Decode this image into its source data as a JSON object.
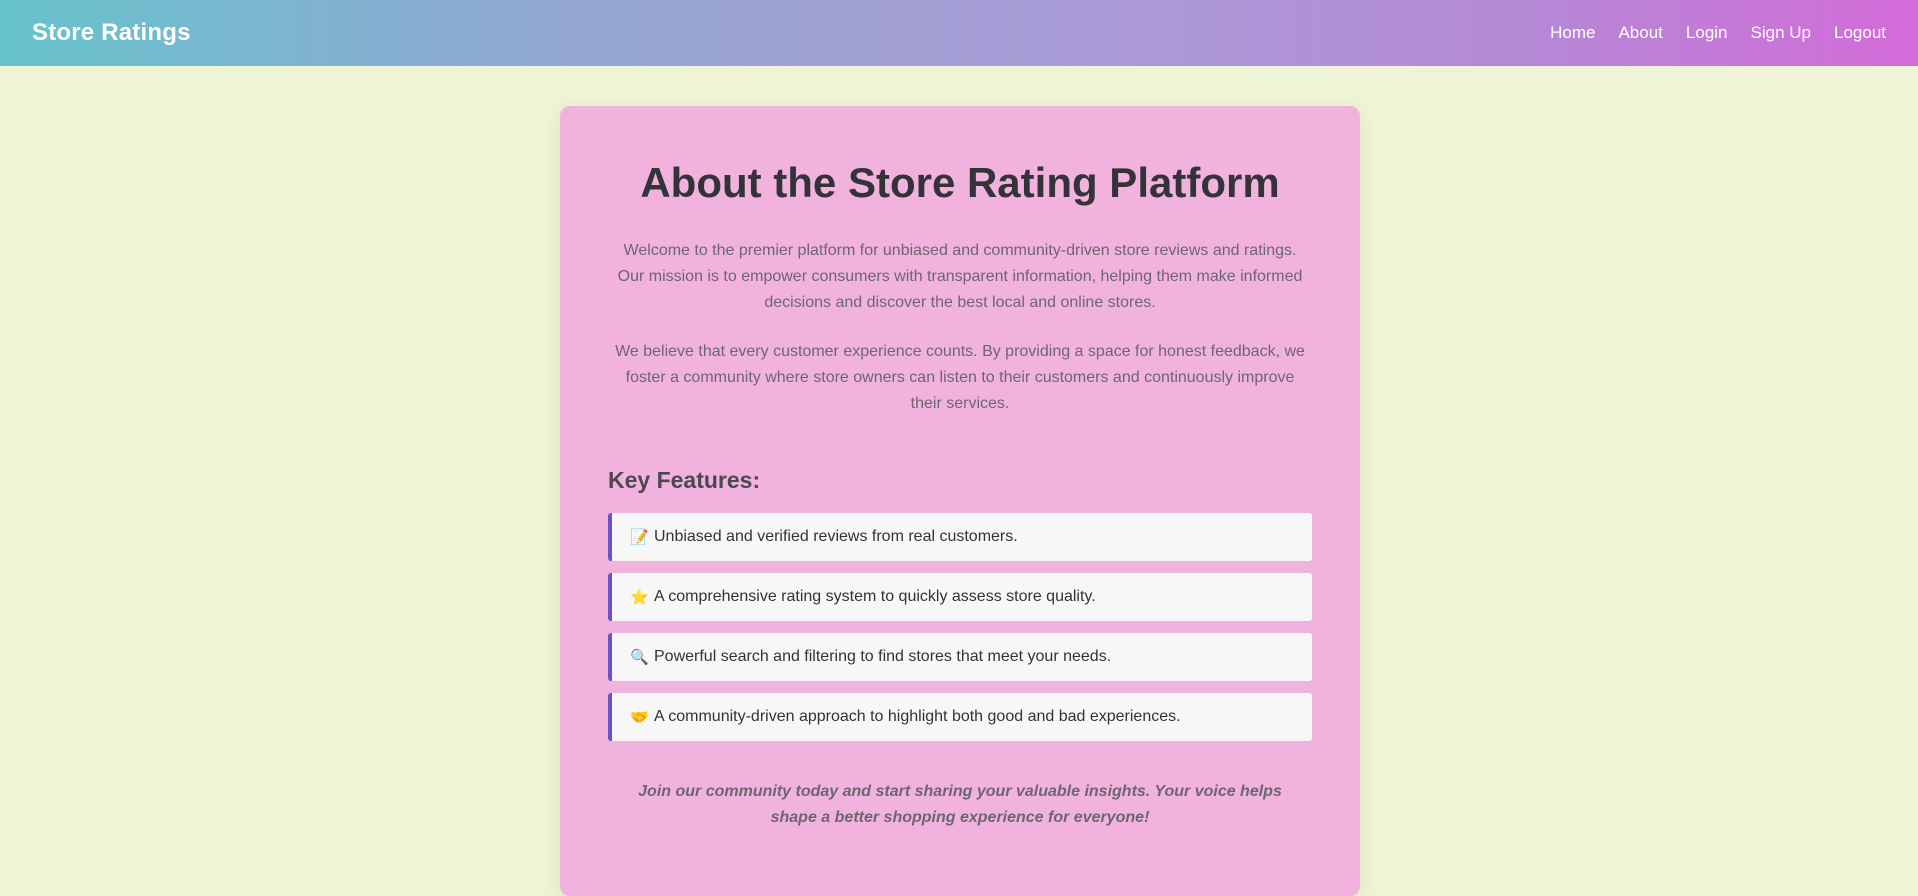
{
  "header": {
    "brand": "Store Ratings",
    "nav": [
      "Home",
      "About",
      "Login",
      "Sign Up",
      "Logout"
    ]
  },
  "main": {
    "title": "About the Store Rating Platform",
    "paragraphs": [
      "Welcome to the premier platform for unbiased and community-driven store reviews and ratings. Our mission is to empower consumers with transparent information, helping them make informed decisions and discover the best local and online stores.",
      "We believe that every customer experience counts. By providing a space for honest feedback, we foster a community where store owners can listen to their customers and continuously improve their services."
    ],
    "features_heading": "Key Features:",
    "features": [
      {
        "icon": "📝",
        "icon_name": "memo-icon",
        "text": "Unbiased and verified reviews from real customers."
      },
      {
        "icon": "⭐",
        "icon_name": "star-icon",
        "text": "A comprehensive rating system to quickly assess store quality."
      },
      {
        "icon": "🔍",
        "icon_name": "magnifier-icon",
        "text": "Powerful search and filtering to find stores that meet your needs."
      },
      {
        "icon": "🤝",
        "icon_name": "handshake-icon",
        "text": "A community-driven approach to highlight both good and bad experiences."
      }
    ],
    "closing": "Join our community today and start sharing your valuable insights. Your voice helps shape a better shopping experience for everyone!"
  },
  "colors": {
    "page_background": "#f0f4d6",
    "card_background": "#f1b3de",
    "accent_border": "#6b52c8",
    "nav_gradient_start": "#67c3cd",
    "nav_gradient_end": "#d36bd9"
  }
}
